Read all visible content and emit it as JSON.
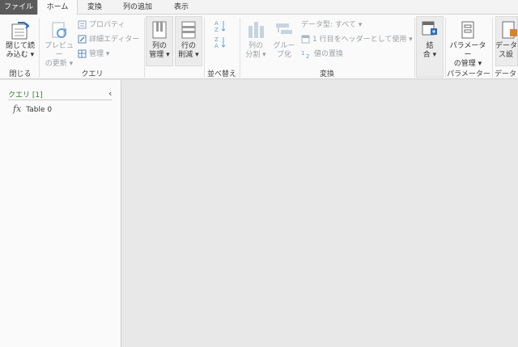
{
  "tabs": [
    {
      "label": "ファイル"
    },
    {
      "label": "ホーム"
    },
    {
      "label": "変換"
    },
    {
      "label": "列の追加"
    },
    {
      "label": "表示"
    }
  ],
  "ribbon": {
    "close": {
      "label1": "閉じて読",
      "label2": "み込む ▾",
      "group": "閉じる"
    },
    "query": {
      "preview": {
        "label1": "プレビュー",
        "label2": "の更新 ▾"
      },
      "properties": "プロパティ",
      "advanced_editor": "詳細エディター",
      "manage": "管理 ▾",
      "group": "クエリ"
    },
    "columns": {
      "label1": "列の",
      "label2": "管理 ▾"
    },
    "rows": {
      "label1": "行の",
      "label2": "削減 ▾"
    },
    "sort": {
      "group": "並べ替え"
    },
    "transform": {
      "split": {
        "label1": "列の",
        "label2": "分割 ▾"
      },
      "groupby": {
        "label1": "グルー",
        "label2": "プ化"
      },
      "datatype": "データ型: すべて ▾",
      "first_row_header": "1 行目をヘッダーとして使用 ▾",
      "replace_values": "値の置換",
      "group": "変換"
    },
    "combine": {
      "label1": "結",
      "label2": "合 ▾"
    },
    "parameters": {
      "label1": "パラメーター",
      "label2": "の管理 ▾",
      "group": "パラメーター"
    },
    "datasource": {
      "label1": "データ",
      "label2": "ス設",
      "group": "データ"
    }
  },
  "query_pane": {
    "header": "クエリ",
    "count": "[1]",
    "collapse_glyph": "‹",
    "items": [
      {
        "icon": "fx",
        "label": "Table 0"
      }
    ]
  }
}
